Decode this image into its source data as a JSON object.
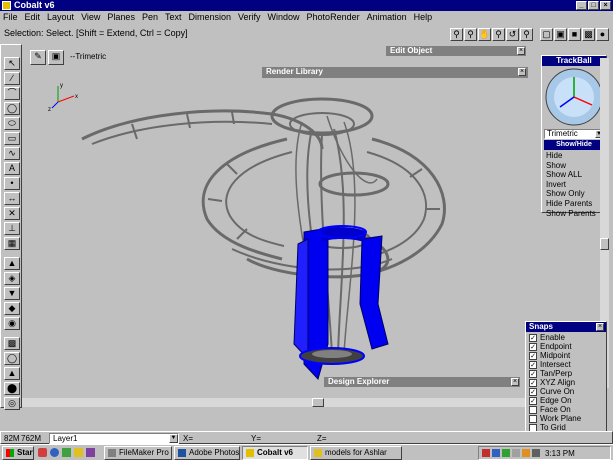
{
  "window": {
    "title": "Cobalt v6"
  },
  "menu": [
    "File",
    "Edit",
    "Layout",
    "View",
    "Planes",
    "Pen",
    "Text",
    "Dimension",
    "Verify",
    "Window",
    "PhotoRender",
    "Animation",
    "Help"
  ],
  "status_prompt": "Selection: Select. [Shift = Extend, Ctrl = Copy]",
  "viewport": {
    "title": "--Trimetric",
    "axis_labels": {
      "x": "x",
      "y": "y",
      "z": "z"
    }
  },
  "panels": {
    "edit_object": "Edit Object",
    "render_library": "Render Library",
    "design_explorer": "Design Explorer"
  },
  "trackball": {
    "title": "TrackBall",
    "view_select": "Trimetric",
    "show_hide_label": "Show/Hide",
    "menu": [
      "Hide",
      "Show",
      "Show ALL",
      "Invert",
      "Show Only",
      "Hide Parents",
      "Show Parents"
    ]
  },
  "snaps": {
    "title": "Snaps",
    "items": [
      {
        "label": "Enable",
        "checked": true
      },
      {
        "label": "Endpoint",
        "checked": true
      },
      {
        "label": "Midpoint",
        "checked": true
      },
      {
        "label": "Intersect",
        "checked": true
      },
      {
        "label": "Tan/Perp",
        "checked": true
      },
      {
        "label": "XYZ Align",
        "checked": true
      },
      {
        "label": "Curve On",
        "checked": true
      },
      {
        "label": "Edge On",
        "checked": true
      },
      {
        "label": "Face On",
        "checked": false
      },
      {
        "label": "Work Plane",
        "checked": false
      },
      {
        "label": "To Grid",
        "checked": false
      },
      {
        "label": "Plane Only",
        "checked": false
      }
    ]
  },
  "statusbar": {
    "memory1": "82M",
    "memory2": "762M",
    "layer": "Layer1",
    "x": "X=",
    "y": "Y=",
    "z": "Z="
  },
  "taskbar": {
    "start": "Start",
    "tasks": [
      "FileMaker Pro -...",
      "Adobe Photoshop",
      "Cobalt v6",
      "models for Ashlar"
    ],
    "clock": "3:13 PM"
  },
  "colors": {
    "title_bar": "#000080",
    "chrome": "#c0c0c0",
    "model_blue": "#0000ff",
    "model_wire": "#707070"
  }
}
